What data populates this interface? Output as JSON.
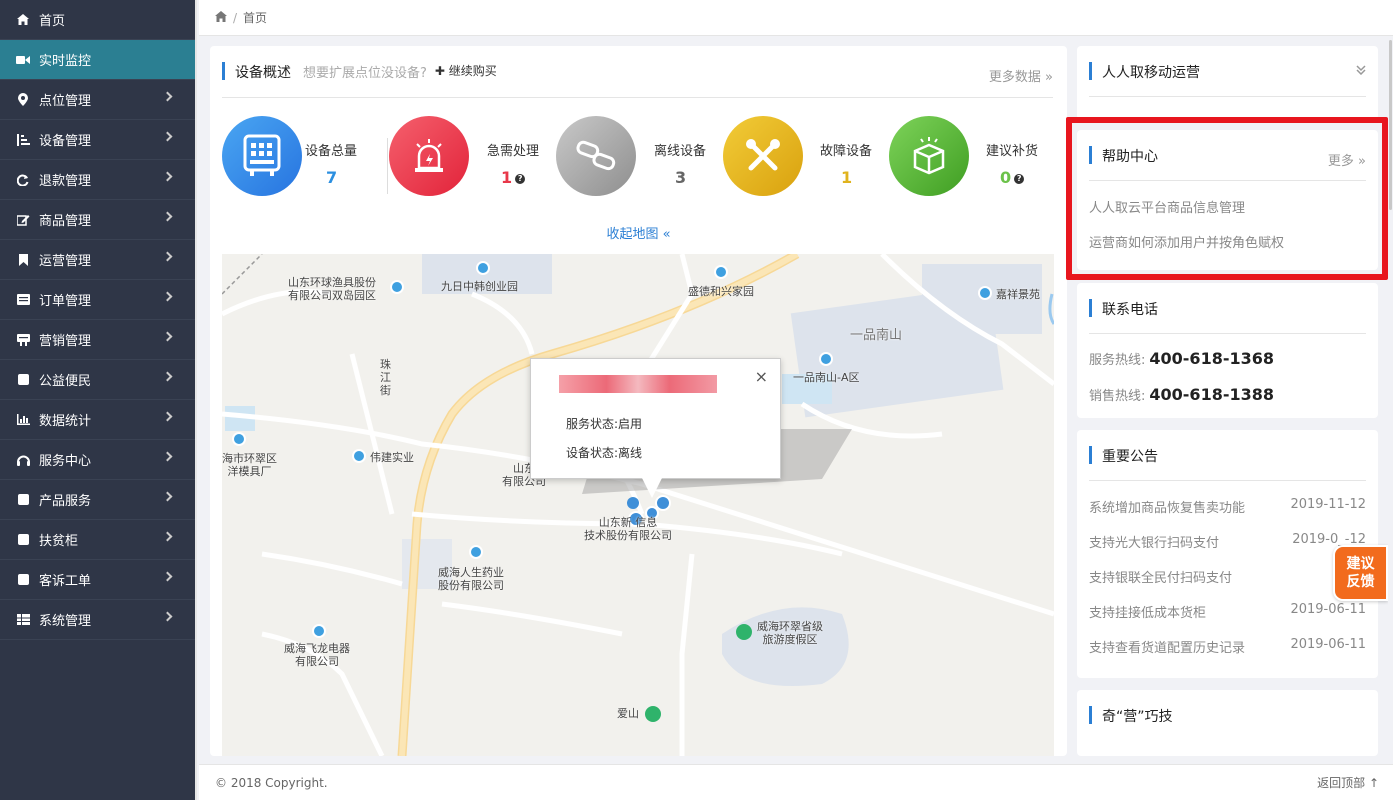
{
  "sidebar": {
    "items": [
      {
        "label": "首页",
        "icon": "home-icon"
      },
      {
        "label": "实时监控",
        "icon": "video-icon"
      },
      {
        "label": "点位管理",
        "icon": "map-marker-icon"
      },
      {
        "label": "设备管理",
        "icon": "sort-icon"
      },
      {
        "label": "退款管理",
        "icon": "refresh-icon"
      },
      {
        "label": "商品管理",
        "icon": "edit-icon"
      },
      {
        "label": "运营管理",
        "icon": "bookmark-icon"
      },
      {
        "label": "订单管理",
        "icon": "list-icon"
      },
      {
        "label": "营销管理",
        "icon": "gift-icon"
      },
      {
        "label": "公益便民",
        "icon": "square-icon"
      },
      {
        "label": "数据统计",
        "icon": "bar-chart-icon"
      },
      {
        "label": "服务中心",
        "icon": "headset-icon"
      },
      {
        "label": "产品服务",
        "icon": "square-icon"
      },
      {
        "label": "扶贫柜",
        "icon": "square-icon"
      },
      {
        "label": "客诉工单",
        "icon": "square-icon"
      },
      {
        "label": "系统管理",
        "icon": "table-icon"
      }
    ],
    "active_index": 1
  },
  "breadcrumb": {
    "sep": "/",
    "current": "首页"
  },
  "overview": {
    "title": "设备概述",
    "subtitle": "想要扩展点位没设备?",
    "buy_label": "继续购买",
    "more_label": "更多数据 »",
    "stats": [
      {
        "label": "设备总量",
        "value": "7",
        "color": "#2b8fe0",
        "icon": "vending-machine-icon",
        "help": false
      },
      {
        "label": "急需处理",
        "value": "1",
        "color": "#e8384a",
        "icon": "alarm-icon",
        "help": true
      },
      {
        "label": "离线设备",
        "value": "3",
        "color": "#666666",
        "icon": "broken-link-icon",
        "help": false
      },
      {
        "label": "故障设备",
        "value": "1",
        "color": "#e0b31e",
        "icon": "tools-icon",
        "help": false
      },
      {
        "label": "建议补货",
        "value": "0",
        "color": "#6cc24a",
        "icon": "box-icon",
        "help": true
      }
    ],
    "collapse_label": "收起地图 «"
  },
  "map": {
    "labels": [
      {
        "text": "山东环球渔具股份\n有限公司双岛园区"
      },
      {
        "text": "九日中韩创业园"
      },
      {
        "text": "盛德和兴家园"
      },
      {
        "text": "嘉祥景苑"
      },
      {
        "text": "一品南山"
      },
      {
        "text": "一品南山-A区"
      },
      {
        "text": "珠\n江\n街"
      },
      {
        "text": "海市环翠区\n洋模具厂"
      },
      {
        "text": "伟建实业"
      },
      {
        "text": "山东\n有限公司"
      },
      {
        "text": "山东新  信息\n技术股份有限公司"
      },
      {
        "text": "威海人生药业\n股份有限公司"
      },
      {
        "text": "威海环翠省级\n旅游度假区"
      },
      {
        "text": "威海飞龙电器\n有限公司"
      },
      {
        "text": "爱山"
      }
    ],
    "popup": {
      "service_status_key": "服务状态:",
      "service_status_val": "启用",
      "device_status_key": "设备状态:",
      "device_status_val": "离线",
      "close": "×"
    }
  },
  "right": {
    "rr_title": "人人取移动运营",
    "help": {
      "title": "帮助中心",
      "more": "更多 »",
      "links": [
        "人人取云平台商品信息管理",
        "运营商如何添加用户并按角色赋权"
      ]
    },
    "contact": {
      "title": "联系电话",
      "service_key": "服务热线:",
      "service_val": "400-618-1368",
      "sales_key": "销售热线:",
      "sales_val": "400-618-1388"
    },
    "notice": {
      "title": "重要公告",
      "items": [
        {
          "text": "系统增加商品恢复售卖功能",
          "date": "2019-11-12"
        },
        {
          "text": "支持光大银行扫码支付",
          "date": "2019-0_-12"
        },
        {
          "text": "支持银联全民付扫码支付",
          "date": "2019"
        },
        {
          "text": "支持挂接低成本货柜",
          "date": "2019-06-11"
        },
        {
          "text": "支持查看货道配置历史记录",
          "date": "2019-06-11"
        }
      ]
    },
    "tips_title": "奇“营”巧技"
  },
  "feedback": {
    "line1": "建议",
    "line2": "反馈"
  },
  "footer": {
    "copyright": "© 2018 Copyright.",
    "back_top": "返回顶部 ↑"
  }
}
